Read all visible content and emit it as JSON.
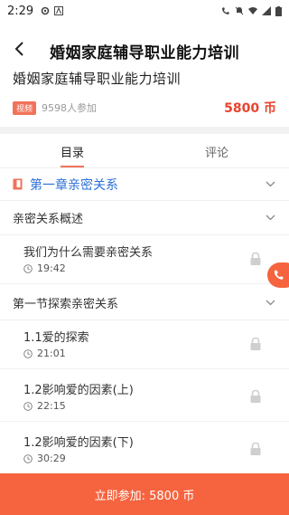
{
  "status_bar": {
    "time": "2:29"
  },
  "header": {
    "title": "婚姻家庭辅导职业能力培训"
  },
  "course": {
    "title": "婚姻家庭辅导职业能力培训",
    "badge": "视频",
    "participants": "9598人参加",
    "price": "5800 币"
  },
  "tabs": [
    {
      "label": "目录"
    },
    {
      "label": "评论"
    }
  ],
  "chapter": {
    "title": "第一章亲密关系"
  },
  "sections": [
    {
      "title": "亲密关系概述",
      "lessons": [
        {
          "title": "我们为什么需要亲密关系",
          "duration": "19:42"
        }
      ]
    },
    {
      "title": "第一节探索亲密关系",
      "lessons": [
        {
          "title": "1.1爱的探索",
          "duration": "21:01"
        },
        {
          "title": "1.2影响爱的因素(上)",
          "duration": "22:15"
        },
        {
          "title": "1.2影响爱的因素(下)",
          "duration": "30:29"
        }
      ]
    }
  ],
  "bottom": {
    "join_label": "立即参加: 5800 币"
  },
  "colors": {
    "accent": "#f5643f",
    "price": "#e8432e",
    "chapter": "#2a6fd6"
  }
}
